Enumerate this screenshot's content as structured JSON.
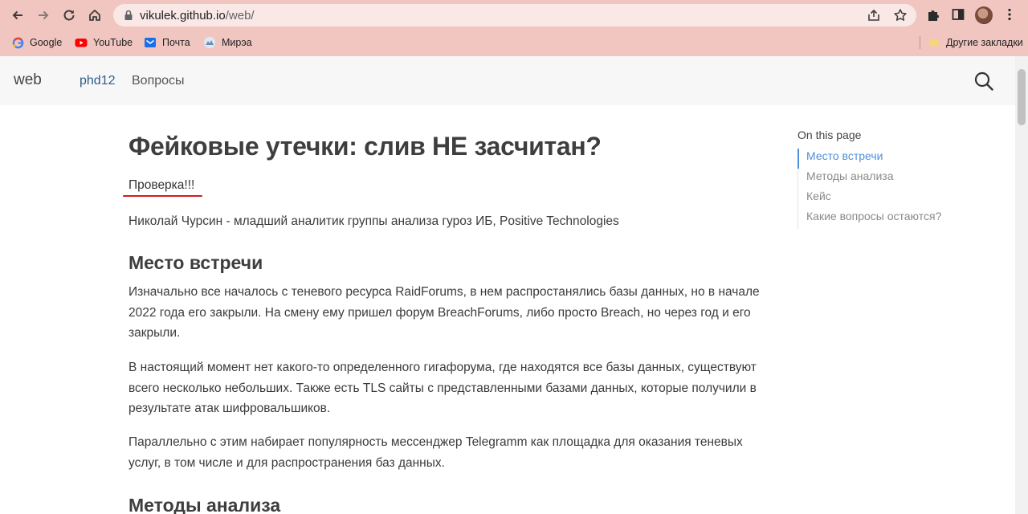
{
  "browser": {
    "url_host": "vikulek.github.io",
    "url_path": "/web/",
    "bookmarks": [
      {
        "label": "Google",
        "icon": "google-icon"
      },
      {
        "label": "YouTube",
        "icon": "youtube-icon"
      },
      {
        "label": "Почта",
        "icon": "mail-icon"
      },
      {
        "label": "Мирэа",
        "icon": "mirea-icon"
      }
    ],
    "other_bookmarks": "Другие закладки"
  },
  "header": {
    "brand": "web",
    "nav": [
      "phd12",
      "Вопросы"
    ]
  },
  "article": {
    "title": "Фейковые утечки: слив НЕ засчитан?",
    "check": "Проверка!!!",
    "author": "Николай Чурсин - младший аналитик группы анализа гуроз ИБ, Positive Technologies",
    "sections": [
      {
        "heading": "Место встречи",
        "paragraphs": [
          "Изначально все началось с теневого ресурса RaidForums, в нем распростанялись базы данных, но в начале 2022 года его закрыли. На смену ему пришел форум BreachForums, либо просто Breach, но через год и его закрыли.",
          "В настоящий момент нет какого-то определенного гигафорума, где находятся все базы данных, существуют всего несколько небольших. Также есть TLS сайты с представленными базами данных, которые получили в результате атак шифровальшиков.",
          "Параллельно с этим набирает популярность мессенджер Telegramm как площадка для оказания теневых услуг, в том числе и для распространения баз данных."
        ]
      },
      {
        "heading": "Методы анализа",
        "paragraphs": []
      }
    ]
  },
  "toc": {
    "title": "On this page",
    "items": [
      "Место встречи",
      "Методы анализа",
      "Кейс",
      "Какие вопросы остаются?"
    ],
    "active_index": 0
  },
  "colors": {
    "chrome": "#f2c6c0",
    "accent": "#4f8fd8",
    "underline": "#d31d1d"
  }
}
